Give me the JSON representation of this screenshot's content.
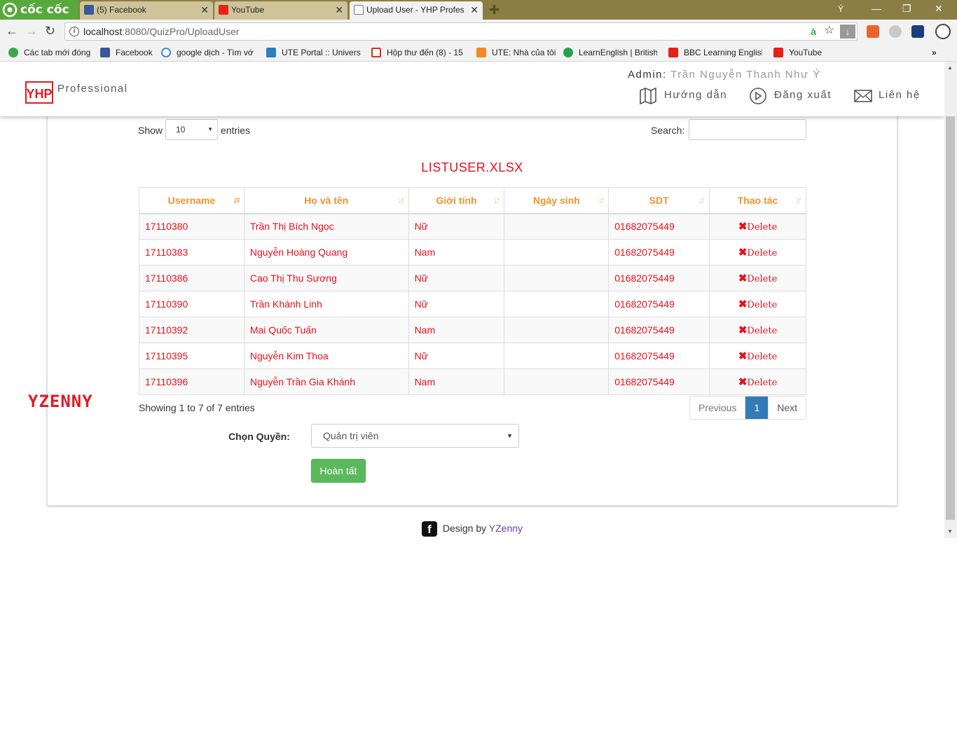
{
  "browser": {
    "brand": "cốc cốc",
    "tabs": [
      {
        "title": "(5) Facebook",
        "icon": "facebook-icon",
        "color": "#3b5998"
      },
      {
        "title": "YouTube",
        "icon": "youtube-icon",
        "color": "#e62117"
      },
      {
        "title": "Upload User - YHP Profes",
        "icon": "yhp-icon",
        "color": "#555555",
        "active": true
      }
    ],
    "window_user": "Ý",
    "url_host": "localhost",
    "url_rest": ":8080/QuizPro/UploadUser",
    "bookmarks": [
      {
        "label": "Các tab mới đóng",
        "icon": "recent-tabs-icon",
        "color": "#3aa84a"
      },
      {
        "label": "Facebook",
        "icon": "facebook-icon",
        "color": "#3b5998"
      },
      {
        "label": "google dịch - Tìm vớ",
        "icon": "google-icon",
        "color": "#4285f4"
      },
      {
        "label": "UTE Portal :: Universit",
        "icon": "ute-portal-icon",
        "color": "#2a7ec7"
      },
      {
        "label": "Hộp thư đến (8) - 15",
        "icon": "gmail-icon",
        "color": "#d93025"
      },
      {
        "label": "UTE: Nhà của tôi",
        "icon": "moodle-icon",
        "color": "#f08a24"
      },
      {
        "label": "LearnEnglish | British",
        "icon": "british-council-icon",
        "color": "#23a24d"
      },
      {
        "label": "BBC Learning English",
        "icon": "youtube-icon",
        "color": "#e62117"
      },
      {
        "label": "YouTube",
        "icon": "youtube-icon",
        "color": "#e62117"
      }
    ]
  },
  "header": {
    "brand_mark": "YHP",
    "brand": "Professional",
    "admin_label": "Admin:",
    "admin_name": "Trần Nguyễn Thanh Như Ý",
    "nav": [
      {
        "label": "Hướng dẫn",
        "icon": "map-icon"
      },
      {
        "label": "Đăng xuất",
        "icon": "logout-icon"
      },
      {
        "label": "Liên hệ",
        "icon": "mail-icon"
      }
    ]
  },
  "table_controls": {
    "show_label": "Show",
    "entries_value": "10",
    "entries_label": "entries",
    "search_label": "Search:",
    "search_value": ""
  },
  "file_title": "LISTUSER.XLSX",
  "columns": [
    "Username",
    "Họ và tên",
    "Giới tính",
    "Ngày sinh",
    "SDT",
    "Thao tác"
  ],
  "rows": [
    {
      "username": "17110380",
      "name": "Trần Thị Bích Ngọc",
      "gender": "Nữ",
      "dob": "",
      "phone": "01682075449",
      "action": "Delete"
    },
    {
      "username": "17110383",
      "name": "Nguyễn Hoàng Quang",
      "gender": "Nam",
      "dob": "",
      "phone": "01682075449",
      "action": "Delete"
    },
    {
      "username": "17110386",
      "name": "Cao Thị Thu Sương",
      "gender": "Nữ",
      "dob": "",
      "phone": "01682075449",
      "action": "Delete"
    },
    {
      "username": "17110390",
      "name": "Trần Khánh Linh",
      "gender": "Nữ",
      "dob": "",
      "phone": "01682075449",
      "action": "Delete"
    },
    {
      "username": "17110392",
      "name": "Mai Quốc Tuấn",
      "gender": "Nam",
      "dob": "",
      "phone": "01682075449",
      "action": "Delete"
    },
    {
      "username": "17110395",
      "name": "Nguyễn Kim Thoa",
      "gender": "Nữ",
      "dob": "",
      "phone": "01682075449",
      "action": "Delete"
    },
    {
      "username": "17110396",
      "name": "Nguyễn Trần Gia Khánh",
      "gender": "Nam",
      "dob": "",
      "phone": "01682075449",
      "action": "Delete"
    }
  ],
  "pagination": {
    "info": "Showing 1 to 7 of 7 entries",
    "previous": "Previous",
    "current": "1",
    "next": "Next"
  },
  "role": {
    "label": "Chọn Quyền:",
    "selected": "Quản trị viên"
  },
  "submit_label": "Hoàn tất",
  "watermark": "YZENNY",
  "footer": {
    "prefix": "Design by",
    "brand": "YZenny"
  },
  "colors": {
    "accent_red": "#e8101a",
    "header_orange": "#f0932b",
    "pager_blue": "#337ab7",
    "button_green": "#5cb85c"
  }
}
